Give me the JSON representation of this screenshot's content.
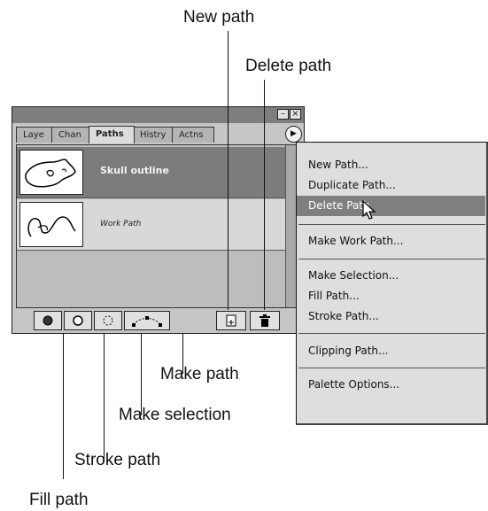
{
  "callouts": {
    "new_path": "New path",
    "delete_path": "Delete path",
    "make_path": "Make path",
    "make_selection": "Make selection",
    "stroke_path": "Stroke path",
    "fill_path": "Fill path"
  },
  "palette": {
    "title_buttons": {
      "minimize": "–",
      "close": "×"
    },
    "tabs": [
      "Laye",
      "Chan",
      "Paths",
      "Histry",
      "Actns"
    ],
    "active_tab": "Paths",
    "paths": [
      {
        "name": "Skull outline",
        "selected": true
      },
      {
        "name": "Work Path",
        "selected": false
      }
    ]
  },
  "menu": {
    "items": [
      "New Path...",
      "Duplicate Path...",
      "Delete Path",
      "Make Work Path...",
      "Make Selection...",
      "Fill Path...",
      "Stroke Path...",
      "Clipping Path...",
      "Palette Options..."
    ],
    "highlighted": "Delete Path"
  },
  "colors": {
    "panel_bg": "#c6c6c6",
    "title_bar": "#7e7e7e",
    "selection": "#7c7c7c",
    "menu_bg": "#dedede"
  }
}
